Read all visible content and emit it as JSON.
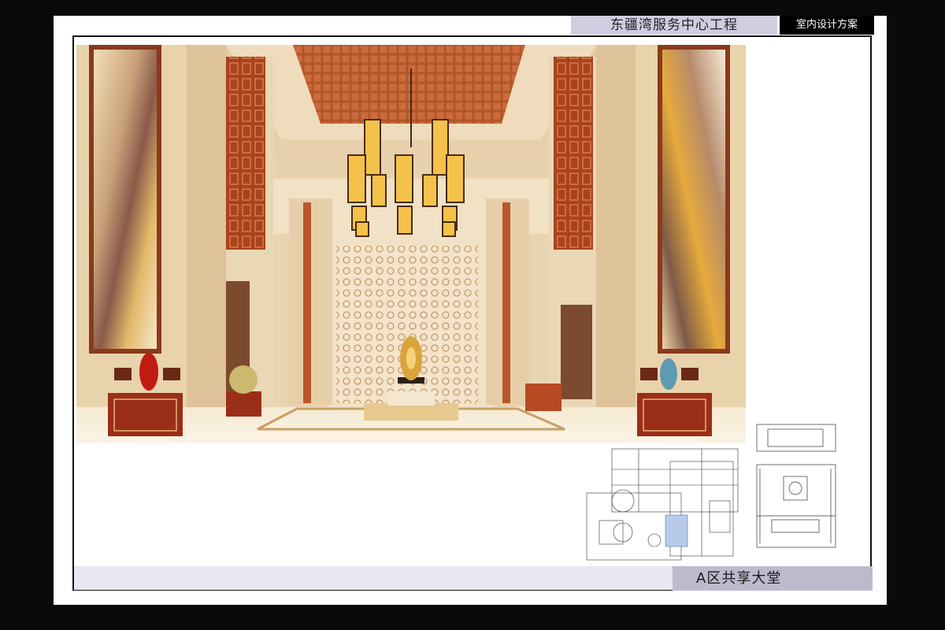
{
  "header": {
    "project_title": "东疆湾服务中心工程",
    "scheme_label": "室内设计方案"
  },
  "caption": {
    "area_label": "A区共享大堂"
  },
  "colors": {
    "background": "#0a0a0a",
    "title_bar": "#cfcde0",
    "caption_bar": "#bdbace",
    "wood": "#a8431f",
    "cream_wall": "#ecd9b6",
    "gold_light": "#f4c24a"
  },
  "images": {
    "main_render": "lobby-interior-rendering",
    "plan_a": "floor-plan-overview",
    "plan_b": "lobby-furniture-plan"
  }
}
